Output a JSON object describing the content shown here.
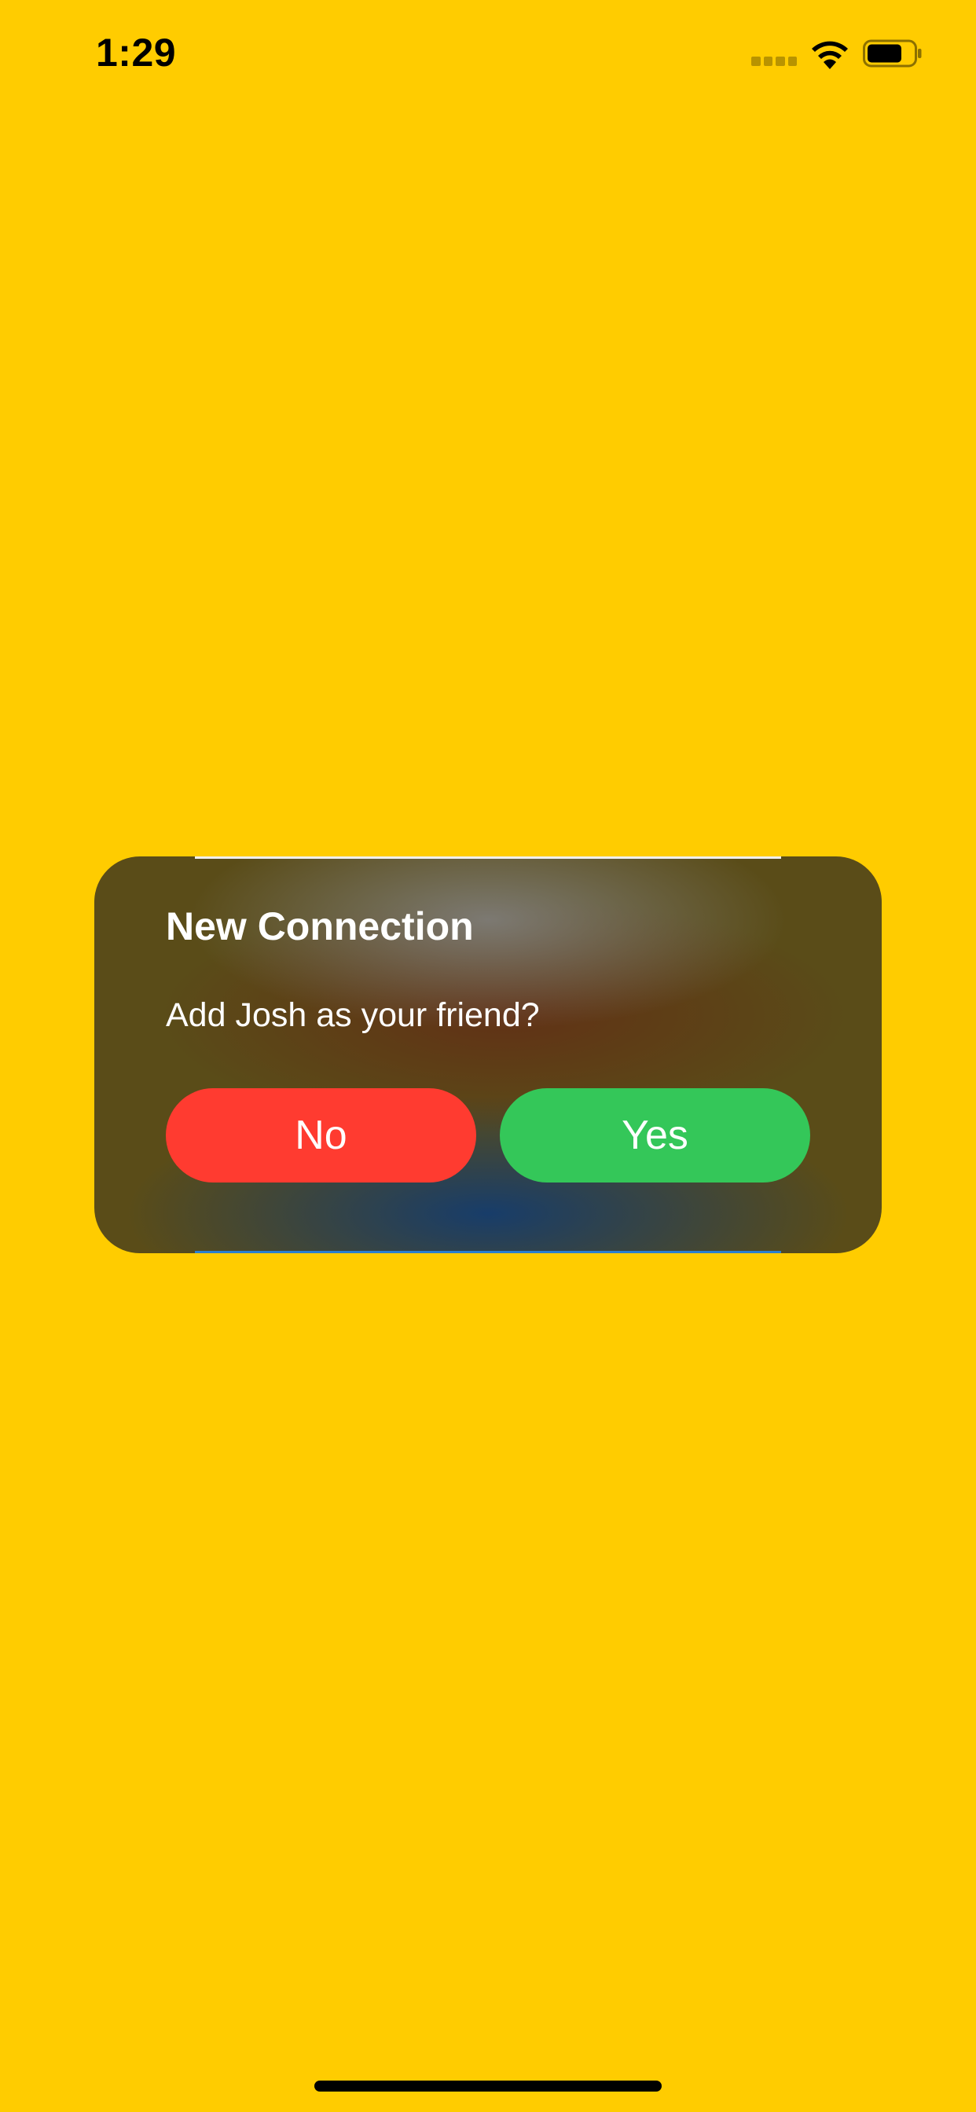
{
  "status_bar": {
    "time": "1:29",
    "icons": [
      "signal-dots-icon",
      "wifi-icon",
      "battery-icon"
    ]
  },
  "alert": {
    "title": "New Connection",
    "message": "Add Josh as your friend?",
    "no_label": "No",
    "yes_label": "Yes"
  },
  "colors": {
    "background": "#FFCC00",
    "no_button": "#FF3B30",
    "yes_button": "#34C759",
    "card": "#5a4c18",
    "text": "#FFFFFF"
  }
}
